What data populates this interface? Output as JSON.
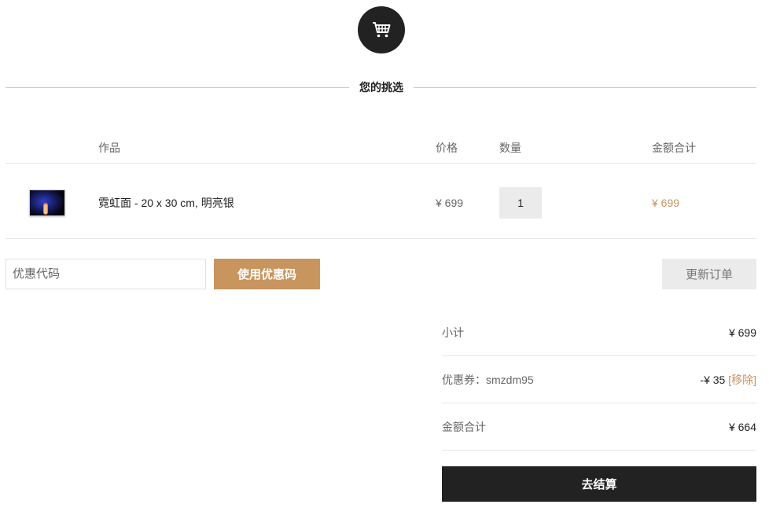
{
  "header": {
    "title": "您的挑选",
    "cart_icon": "shopping-cart-icon"
  },
  "table": {
    "headers": {
      "product": "作品",
      "price": "价格",
      "quantity": "数量",
      "total": "金额合计"
    },
    "rows": [
      {
        "name": "霓虹面 - 20 x 30 cm, 明亮银",
        "price": "¥ 699",
        "quantity": "1",
        "total": "¥ 699"
      }
    ]
  },
  "coupon": {
    "placeholder": "优惠代码",
    "apply_label": "使用优惠码"
  },
  "update_label": "更新订单",
  "summary": {
    "subtotal_label": "小计",
    "subtotal_value": "¥ 699",
    "coupon_label": "优惠券：smzdm95",
    "coupon_value": "-¥ 35",
    "remove_label": "[移除]",
    "total_label": "金额合计",
    "total_value": "¥ 664"
  },
  "checkout_label": "去结算",
  "colors": {
    "accent": "#c8955e",
    "dark": "#222222",
    "light_button": "#ebebeb"
  }
}
